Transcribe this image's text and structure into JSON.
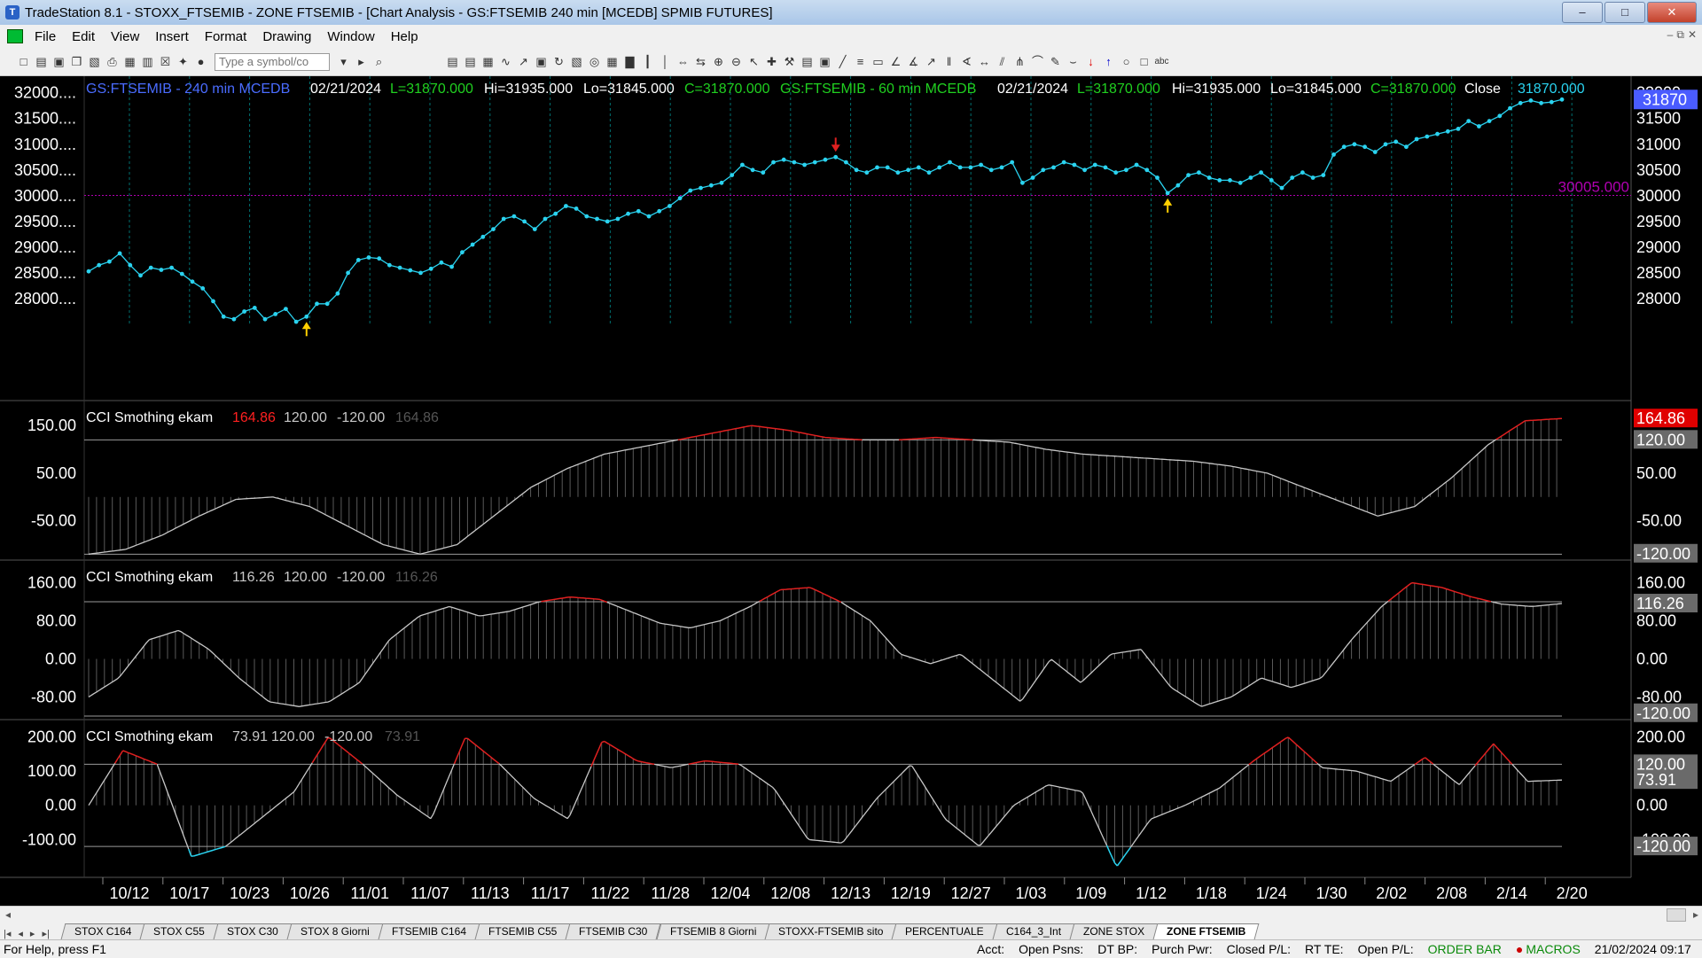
{
  "window": {
    "title": "TradeStation 8.1 - STOXX_FTSEMIB - ZONE FTSEMIB - [Chart Analysis - GS:FTSEMIB  240 min  [MCEDB] SPMIB FUTURES]",
    "app_icon": "tradestation-logo-icon"
  },
  "menu": {
    "items": [
      "File",
      "Edit",
      "View",
      "Insert",
      "Format",
      "Drawing",
      "Window",
      "Help"
    ]
  },
  "toolbar": {
    "symbol_placeholder": "Type a symbol/co"
  },
  "price_pane": {
    "header_left": "GS:FTSEMIB - 240 min   MCEDB",
    "date": "02/21/2024",
    "open": "L=31870.000",
    "high": "Hi=31935.000",
    "low": "Lo=31845.000",
    "close": "C=31870.000",
    "header2": "GS:FTSEMIB - 60 min   MCEDB",
    "date2": "02/21/2024",
    "open2": "L=31870.000",
    "high2": "Hi=31935.000",
    "low2": "Lo=31845.000",
    "close2": "C=31870.000",
    "close_label": "Close",
    "close_value": "31870.000",
    "last_price_tag": "31870",
    "level_label": "30005.000",
    "axis_ticks": [
      "32000.00",
      "31500.00",
      "31000.00",
      "30500.00",
      "30000.00",
      "29500.00",
      "29000.00",
      "28500.00",
      "28000.00"
    ],
    "left_ticks": [
      "32000....",
      "31500....",
      "31000....",
      "30500....",
      "30000....",
      "29500....",
      "29000....",
      "28500....",
      "28000...."
    ]
  },
  "cci_panes": [
    {
      "name": "CCI Smothing ekam",
      "value": "164.86",
      "upper": "120.00",
      "lower": "-120.00",
      "value2": "164.86",
      "left_ticks": [
        "150.00",
        "50.00",
        "-50.00"
      ],
      "right_ticks": [
        "164.86",
        "120.00",
        "50.00",
        "-50.00",
        "-120.00"
      ]
    },
    {
      "name": "CCI Smothing ekam",
      "value": "116.26",
      "upper": "120.00",
      "lower": "-120.00",
      "value2": "116.26",
      "left_ticks": [
        "160.00",
        "80.00",
        "0.00",
        "-80.00"
      ],
      "right_ticks": [
        "160.00",
        "116.26",
        "80.00",
        "0.00",
        "-80.00",
        "-120.00"
      ]
    },
    {
      "name": "CCI Smothing ekam",
      "value": "73.91",
      "upper": "120.00",
      "lower": "-120.00",
      "value2": "73.91",
      "left_ticks": [
        "200.00",
        "100.00",
        "0.00",
        "-100.00"
      ],
      "right_ticks": [
        "200.00",
        "120.00",
        "73.91",
        "0.00",
        "-100.00",
        "-120.00"
      ]
    }
  ],
  "date_axis": [
    "10/12",
    "10/17",
    "10/23",
    "10/26",
    "11/01",
    "11/07",
    "11/13",
    "11/17",
    "11/22",
    "11/28",
    "12/04",
    "12/08",
    "12/13",
    "12/19",
    "12/27",
    "1/03",
    "1/09",
    "1/12",
    "1/18",
    "1/24",
    "1/30",
    "2/02",
    "2/08",
    "2/14",
    "2/20"
  ],
  "chart_data": [
    {
      "type": "line",
      "series": [
        {
          "values": [
            28530,
            28650,
            28720,
            28880,
            28650,
            28450,
            28600,
            28560,
            28600,
            28480,
            28330,
            28200,
            27950,
            27650,
            27600,
            27750,
            27820,
            27600,
            27700,
            27800,
            27550,
            27650,
            27900,
            27900,
            28100,
            28500,
            28750,
            28800,
            28780,
            28650,
            28600,
            28550,
            28500,
            28580,
            28700,
            28620,
            28900,
            29050,
            29200,
            29350,
            29550,
            29600,
            29500,
            29350,
            29550,
            29650,
            29800,
            29750,
            29600,
            29550,
            29500,
            29550,
            29650,
            29700,
            29600,
            29700,
            29800,
            29950,
            30100,
            30150,
            30200,
            30250,
            30400,
            30600,
            30500,
            30450,
            30650,
            30700,
            30650,
            30600,
            30650,
            30700,
            30750,
            30650,
            30500,
            30450,
            30550,
            30550,
            30450,
            30500,
            30550,
            30450,
            30550,
            30650,
            30550,
            30550,
            30600,
            30500,
            30550,
            30650,
            30250,
            30350,
            30500,
            30550,
            30650,
            30600,
            30500,
            30600,
            30550,
            30450,
            30500,
            30600,
            30500,
            30350,
            30050,
            30200,
            30400,
            30450,
            30350,
            30300,
            30300,
            30250,
            30350,
            30450,
            30300,
            30150,
            30350,
            30450,
            30350,
            30400,
            30800,
            30950,
            31000,
            30950,
            30850,
            31000,
            31050,
            30950,
            31100,
            31150,
            31200,
            31250,
            31300,
            31450,
            31350,
            31450,
            31550,
            31700,
            31800,
            31850,
            31800,
            31820,
            31870
          ]
        }
      ],
      "ylim": [
        27500,
        32150
      ]
    },
    {
      "type": "area",
      "series": [
        {
          "name": "CCI Smothing ekam",
          "values": [
            -120,
            -110,
            -80,
            -40,
            -5,
            0,
            -20,
            -60,
            -100,
            -120,
            -100,
            -40,
            20,
            60,
            90,
            105,
            120,
            135,
            150,
            140,
            125,
            120,
            120,
            125,
            120,
            115,
            100,
            90,
            85,
            80,
            75,
            65,
            50,
            20,
            -10,
            -40,
            -20,
            40,
            110,
            160,
            164.86
          ]
        }
      ],
      "ylim": [
        -125,
        195
      ],
      "levels": [
        120,
        -120,
        0
      ]
    },
    {
      "type": "area",
      "series": [
        {
          "name": "CCI Smothing ekam",
          "values": [
            -80,
            -40,
            40,
            60,
            20,
            -40,
            -90,
            -100,
            -90,
            -50,
            40,
            90,
            110,
            90,
            100,
            120,
            130,
            125,
            100,
            75,
            65,
            80,
            110,
            145,
            150,
            120,
            80,
            10,
            -10,
            10,
            -40,
            -90,
            0,
            -50,
            10,
            20,
            -60,
            -100,
            -80,
            -40,
            -60,
            -40,
            40,
            110,
            160,
            150,
            130,
            115,
            110,
            116.26
          ]
        }
      ],
      "ylim": [
        -120,
        200
      ],
      "levels": [
        120,
        -120,
        0
      ]
    },
    {
      "type": "area",
      "series": [
        {
          "name": "CCI Smothing ekam",
          "values": [
            0,
            160,
            120,
            -150,
            -120,
            -40,
            40,
            200,
            120,
            30,
            -40,
            200,
            120,
            20,
            -40,
            190,
            130,
            110,
            130,
            120,
            50,
            -100,
            -110,
            20,
            120,
            -40,
            -120,
            0,
            60,
            40,
            -180,
            -40,
            0,
            50,
            130,
            200,
            110,
            100,
            70,
            140,
            60,
            180,
            70,
            73.91
          ]
        }
      ],
      "ylim": [
        -200,
        240
      ],
      "levels": [
        120,
        -120,
        0
      ]
    }
  ],
  "sheet_tabs": [
    "STOX C164",
    "STOX C55",
    "STOX C30",
    "STOX 8 Giorni",
    "FTSEMIB C164",
    "FTSEMIB C55",
    "FTSEMIB C30",
    "FTSEMIB 8 Giorni",
    "STOXX-FTSEMIB sito",
    "PERCENTUALE",
    "C164_3_Int",
    "ZONE STOX",
    "ZONE FTSEMIB"
  ],
  "status": {
    "help": "For Help, press F1",
    "fields": [
      "Acct:",
      "Open Psns:",
      "DT BP:",
      "Purch Pwr:",
      "Closed P/L:",
      "RT TE:",
      "Open P/L:"
    ],
    "order_bar": "ORDER BAR",
    "macros": "MACROS",
    "datetime": "21/02/2024 09:17"
  },
  "colors": {
    "price_line": "#2ad3f0",
    "cci_line": "#c8c8c8",
    "cci_above": "#e02020",
    "cci_below": "#2ad3f0",
    "level_line": "#b000b0",
    "header_blue": "#4a6cff",
    "header_green": "#20d020",
    "grid_vertical": "#007070"
  }
}
